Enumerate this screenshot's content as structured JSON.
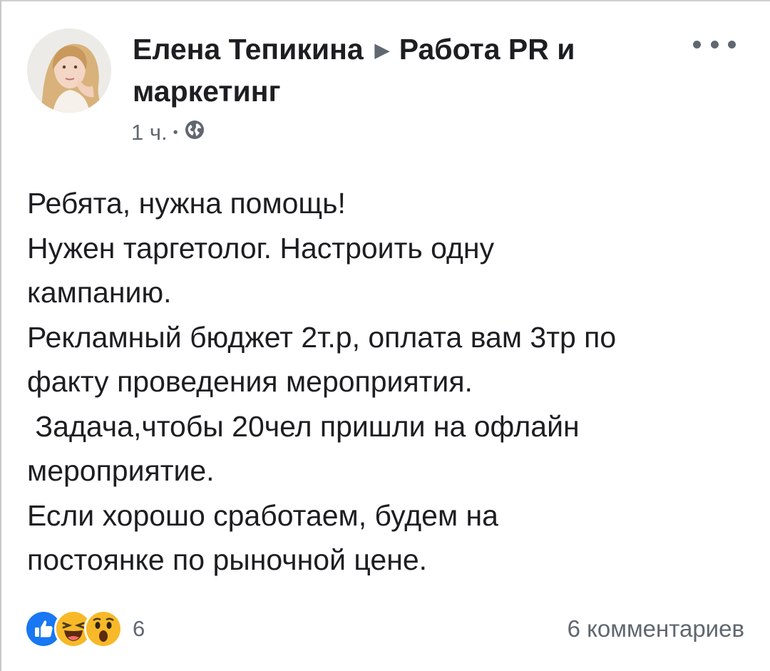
{
  "post": {
    "author": "Елена Тепикина",
    "group": "Работа PR и маркетинг",
    "time": "1 ч.",
    "separator": "•",
    "privacy_icon": "globe-icon",
    "more_icon": "more-horizontal-icon",
    "body_lines": [
      "Ребята, нужна помощь!",
      "Нужен таргетолог. Настроить одну",
      "кампанию.",
      "Рекламный бюджет 2т.р, оплата вам 3тр по",
      "факту проведения мероприятия.",
      " Задача,чтобы 20чел пришли на офлайн",
      "мероприятие.",
      "Если хорошо сработаем, будем на",
      "постоянке по рыночной цене."
    ]
  },
  "footer": {
    "reaction_icons": [
      "like-icon",
      "haha-icon",
      "wow-icon"
    ],
    "reaction_count": "6",
    "comments_label": "6 комментариев"
  },
  "colors": {
    "text_primary": "#1c1e21",
    "text_secondary": "#606770",
    "like_blue": "#1877f2",
    "emoji_yellow": "#f7b928"
  }
}
